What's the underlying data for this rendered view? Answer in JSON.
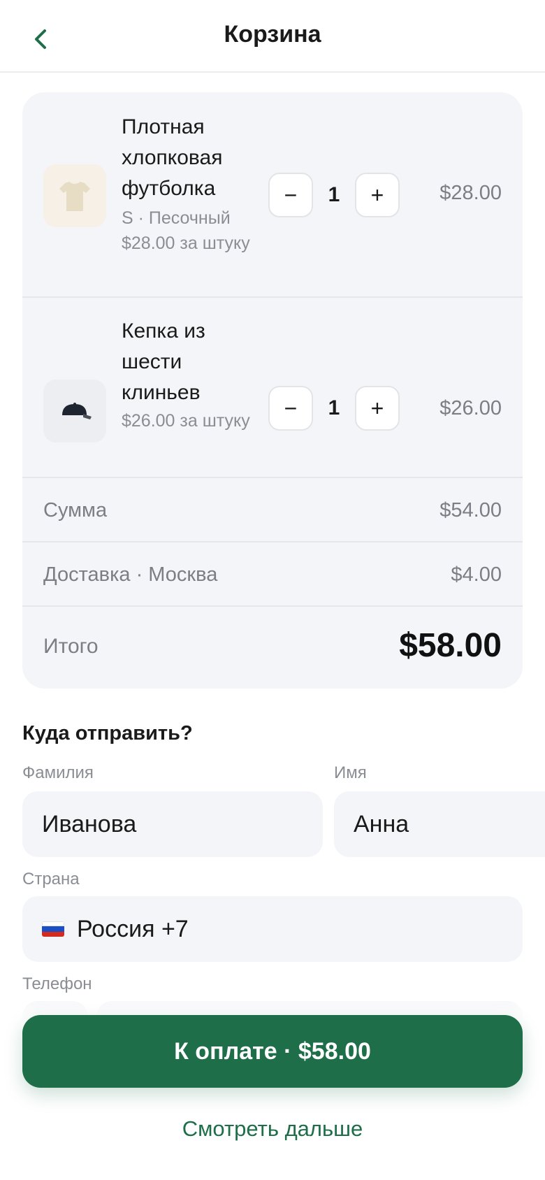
{
  "header": {
    "title": "Корзина",
    "back_icon": "chevron-left-icon"
  },
  "cart": {
    "items": [
      {
        "name": "Плотная хлопковая футболка",
        "variant": "S · Песочный",
        "unit_price": "$28.00 за штуку",
        "quantity": "1",
        "price": "$28.00",
        "icon": "tshirt-icon"
      },
      {
        "name": "Кепка из шести клиньев",
        "unit_price": "$26.00 за штуку",
        "quantity": "1",
        "price": "$26.00",
        "icon": "cap-icon"
      }
    ],
    "minus_label": "−",
    "plus_label": "+",
    "subtotal": {
      "label": "Сумма",
      "value": "$54.00"
    },
    "delivery": {
      "label": "Доставка · Москва",
      "value": "$4.00"
    },
    "total": {
      "label": "Итого",
      "value": "$58.00"
    }
  },
  "shipping": {
    "title": "Куда отправить?",
    "last_name": {
      "label": "Фамилия",
      "value": "Иванова"
    },
    "first_name": {
      "label": "Имя",
      "value": "Анна"
    },
    "country": {
      "label": "Страна",
      "value": "Россия +7",
      "flag": "russia-flag-icon"
    },
    "phone": {
      "label": "Телефон"
    }
  },
  "actions": {
    "pay_label": "К оплате · $58.00",
    "more_label": "Смотреть дальше"
  },
  "colors": {
    "accent": "#1d6e49",
    "card_bg": "#f4f5f8",
    "muted_text": "#7b7e85"
  }
}
